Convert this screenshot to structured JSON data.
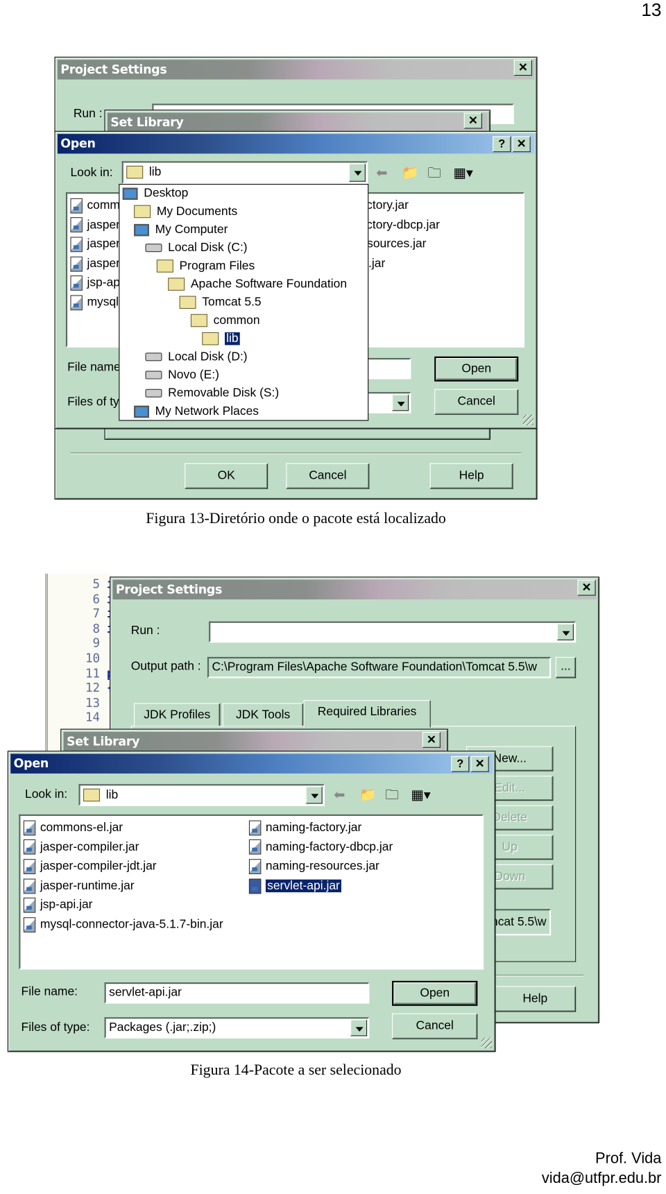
{
  "page_number": "13",
  "footer": {
    "author": "Prof. Vida",
    "email": "vida@utfpr.edu.br"
  },
  "colors": {
    "dialog_bg": "#bfdcc6",
    "active_title": "#0a246a",
    "selection": "#0a246a"
  },
  "figure13": {
    "caption": "Figura 13-Diretório onde o pacote está localizado",
    "project_settings": {
      "title": "Project Settings",
      "run_label": "Run :",
      "run_value": "",
      "ok": "OK",
      "cancel": "Cancel",
      "help": "Help",
      "close": "✕"
    },
    "set_library": {
      "title": "Set Library",
      "close": "✕"
    },
    "open_dialog": {
      "title": "Open",
      "help": "?",
      "close": "✕",
      "look_in_label": "Look in:",
      "look_in_value": "lib",
      "files_left": [
        "commons-el.jar",
        "jasper-compiler.jar",
        "jasper-compiler-jdt.jar",
        "jasper-runtime.jar",
        "jsp-api.jar",
        "mysql-connector-java-5.1.7-bin.jar"
      ],
      "files_right": [
        "naming-factory.jar",
        "naming-factory-dbcp.jar",
        "naming-resources.jar",
        "servlet-api.jar"
      ],
      "file_name_label": "File name:",
      "file_name_value": "",
      "files_of_type_label": "Files of type:",
      "files_of_type_value": "",
      "open": "Open",
      "cancel": "Cancel",
      "look_in_dropdown": [
        {
          "label": "Desktop",
          "icon": "desktop-icon",
          "level": 0
        },
        {
          "label": "My Documents",
          "icon": "my-documents-icon",
          "level": 1
        },
        {
          "label": "My Computer",
          "icon": "my-computer-icon",
          "level": 1
        },
        {
          "label": "Local Disk (C:)",
          "icon": "drive-icon",
          "level": 2
        },
        {
          "label": "Program Files",
          "icon": "folder-icon",
          "level": 3
        },
        {
          "label": "Apache Software Foundation",
          "icon": "folder-icon",
          "level": 4
        },
        {
          "label": "Tomcat 5.5",
          "icon": "folder-icon",
          "level": 5
        },
        {
          "label": "common",
          "icon": "folder-icon",
          "level": 6
        },
        {
          "label": "lib",
          "icon": "folder-open-icon",
          "level": 7,
          "selected": true
        },
        {
          "label": "Local Disk (D:)",
          "icon": "drive-icon",
          "level": 2
        },
        {
          "label": "Novo (E:)",
          "icon": "cd-drive-icon",
          "level": 2
        },
        {
          "label": "Removable Disk (S:)",
          "icon": "removable-drive-icon",
          "level": 2
        },
        {
          "label": "My Network Places",
          "icon": "network-icon",
          "level": 1
        }
      ]
    }
  },
  "figure14": {
    "caption": "Figura 14-Pacote a ser selecionado",
    "editor_line_numbers": [
      "5",
      "6",
      "7",
      "8",
      "9",
      "10",
      "11",
      "12",
      "13",
      "14"
    ],
    "editor_code_chars": [
      "i",
      "i",
      "i",
      "i",
      "",
      "",
      "p",
      "{",
      "",
      ""
    ],
    "project_settings": {
      "title": "Project Settings",
      "close": "✕",
      "run_label": "Run :",
      "run_value": "",
      "output_label": "Output path :",
      "output_value": "C:\\Program Files\\Apache Software Foundation\\Tomcat 5.5\\w",
      "browse": "...",
      "tabs": [
        {
          "label": "JDK Profiles"
        },
        {
          "label": "JDK Tools"
        },
        {
          "label": "Required Libraries",
          "active": true
        }
      ],
      "side_buttons": [
        {
          "label": "New...",
          "enabled": true
        },
        {
          "label": "Edit...",
          "enabled": false
        },
        {
          "label": "Delete",
          "enabled": false
        },
        {
          "label": "Up",
          "enabled": false
        },
        {
          "label": "Down",
          "enabled": false
        }
      ],
      "library_path_value": "C:\\Program Files\\Apache Software Foundation\\Tomcat 5.5\\w",
      "help": "Help"
    },
    "set_library": {
      "title": "Set Library",
      "close": "✕"
    },
    "open_dialog": {
      "title": "Open",
      "help": "?",
      "close": "✕",
      "look_in_label": "Look in:",
      "look_in_value": "lib",
      "files_left": [
        "commons-el.jar",
        "jasper-compiler.jar",
        "jasper-compiler-jdt.jar",
        "jasper-runtime.jar",
        "jsp-api.jar",
        "mysql-connector-java-5.1.7-bin.jar"
      ],
      "files_right": [
        "naming-factory.jar",
        "naming-factory-dbcp.jar",
        "naming-resources.jar",
        "servlet-api.jar"
      ],
      "selected_file": "servlet-api.jar",
      "file_name_label": "File name:",
      "file_name_value": "servlet-api.jar",
      "files_of_type_label": "Files of type:",
      "files_of_type_value": "Packages (.jar;.zip;)",
      "open": "Open",
      "cancel": "Cancel"
    }
  }
}
